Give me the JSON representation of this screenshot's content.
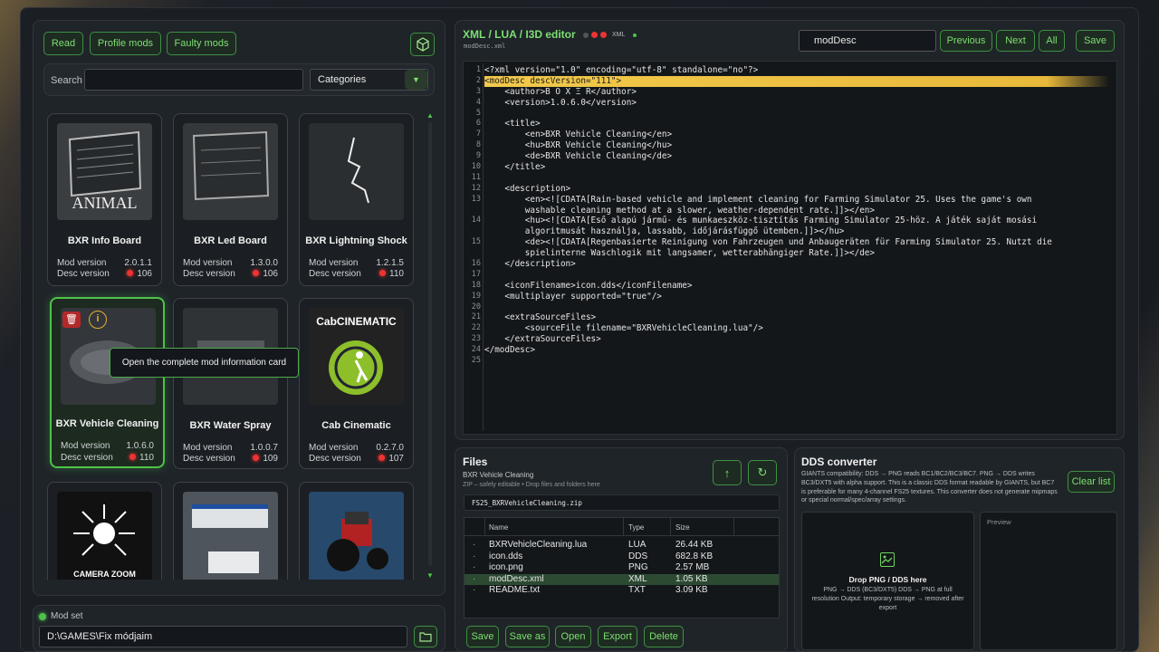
{
  "left": {
    "tabs": [
      "Read",
      "Profile mods",
      "Faulty mods"
    ],
    "search_label": "Search",
    "search_value": "",
    "categories": "Categories"
  },
  "cards": [
    {
      "name": "BXR Info Board",
      "mod_version_label": "Mod version",
      "mod_version": "2.0.1.1",
      "desc_version_label": "Desc version",
      "desc_version": "106",
      "thumb_text": "ANIMAL"
    },
    {
      "name": "BXR Led Board",
      "mod_version_label": "Mod version",
      "mod_version": "1.3.0.0",
      "desc_version_label": "Desc version",
      "desc_version": "106"
    },
    {
      "name": "BXR Lightning Shock",
      "mod_version_label": "Mod version",
      "mod_version": "1.2.1.5",
      "desc_version_label": "Desc version",
      "desc_version": "110"
    },
    {
      "name": "BXR Vehicle Cleaning",
      "mod_version_label": "Mod version",
      "mod_version": "1.0.6.0",
      "desc_version_label": "Desc version",
      "desc_version": "110"
    },
    {
      "name": "BXR Water Spray",
      "mod_version_label": "Mod version",
      "mod_version": "1.0.0.7",
      "desc_version_label": "Desc version",
      "desc_version": "109"
    },
    {
      "name": "Cab Cinematic",
      "mod_version_label": "Mod version",
      "mod_version": "0.2.7.0",
      "desc_version_label": "Desc version",
      "desc_version": "107",
      "thumb_text": "CabCINEMATIC"
    },
    {
      "name": "",
      "thumb_text": "CAMERA ZOOM"
    },
    {
      "name": ""
    },
    {
      "name": ""
    }
  ],
  "tooltip": "Open the complete mod information card",
  "modset": {
    "label": "Mod set",
    "path": "D:\\GAMES\\Fix módjaim"
  },
  "editor": {
    "title": "XML / LUA / I3D editor",
    "badge": "XML",
    "file": "modDesc.xml",
    "search_value": "modDesc",
    "buttons": [
      "Previous",
      "Next",
      "All",
      "Save"
    ],
    "lines": [
      "<?xml version=\"1.0\" encoding=\"utf-8\" standalone=\"no\"?>",
      "<modDesc descVersion=\"111\">",
      "    <author>B O X Ξ R</author>",
      "    <version>1.0.6.0</version>",
      "",
      "    <title>",
      "        <en>BXR Vehicle Cleaning</en>",
      "        <hu>BXR Vehicle Cleaning</hu>",
      "        <de>BXR Vehicle Cleaning</de>",
      "    </title>",
      "",
      "    <description>",
      "        <en><![CDATA[Rain-based vehicle and implement cleaning for Farming Simulator 25. Uses the game's own",
      "        washable cleaning method at a slower, weather-dependent rate.]]></en>",
      "        <hu><![CDATA[Eső alapú jármű- és munkaeszköz-tisztítás Farming Simulator 25-höz. A játék saját mosási",
      "        algoritmusát használja, lassabb, időjárásfüggő ütemben.]]></hu>",
      "        <de><![CDATA[Regenbasierte Reinigung von Fahrzeugen und Anbaugeräten für Farming Simulator 25. Nutzt die",
      "        spielinterne Waschlogik mit langsamer, wetterabhängiger Rate.]]></de>",
      "    </description>",
      "",
      "    <iconFilename>icon.dds</iconFilename>",
      "    <multiplayer supported=\"true\"/>",
      "",
      "    <extraSourceFiles>",
      "        <sourceFile filename=\"BXRVehicleCleaning.lua\"/>",
      "    </extraSourceFiles>",
      "</modDesc>",
      ""
    ],
    "line_numbers": [
      "1",
      "2",
      "3",
      "4",
      "5",
      "6",
      "7",
      "8",
      "9",
      "10",
      "11",
      "12",
      "13",
      "",
      "14",
      "",
      "15",
      "",
      "16",
      "17",
      "18",
      "19",
      "20",
      "21",
      "22",
      "23",
      "24",
      "25"
    ]
  },
  "files": {
    "title": "Files",
    "subtitle": "BXR Vehicle Cleaning",
    "hint": "ZIP – safely editable  •  Drop files and folders here",
    "zip": "FS25_BXRVehicleCleaning.zip",
    "columns": [
      "Name",
      "Type",
      "Size"
    ],
    "rows": [
      {
        "name": "BXRVehicleCleaning.lua",
        "type": "LUA",
        "size": "26.44 KB"
      },
      {
        "name": "icon.dds",
        "type": "DDS",
        "size": "682.8 KB"
      },
      {
        "name": "icon.png",
        "type": "PNG",
        "size": "2.57 MB"
      },
      {
        "name": "modDesc.xml",
        "type": "XML",
        "size": "1.05 KB"
      },
      {
        "name": "README.txt",
        "type": "TXT",
        "size": "3.09 KB"
      }
    ],
    "actions": [
      "Save",
      "Save as",
      "Open",
      "Export",
      "Delete"
    ]
  },
  "dds": {
    "title": "DDS converter",
    "info": "GIANTS compatibility: DDS → PNG reads BC1/BC2/BC3/BC7. PNG → DDS writes BC3/DXT5 with alpha support. This is a classic DDS format readable by GIANTS, but BC7 is preferable for many 4-channel FS25 textures. This converter does not generate mipmaps or special normal/spec/array settings.",
    "clear": "Clear list",
    "drop_title": "Drop PNG / DDS here",
    "drop_text": "PNG → DDS (BC3/DXT5) DDS → PNG at full resolution Output: temporary storage → removed after export",
    "preview": "Preview"
  },
  "colors": {
    "accent": "#4ec24a",
    "highlight": "#f2c94c"
  }
}
